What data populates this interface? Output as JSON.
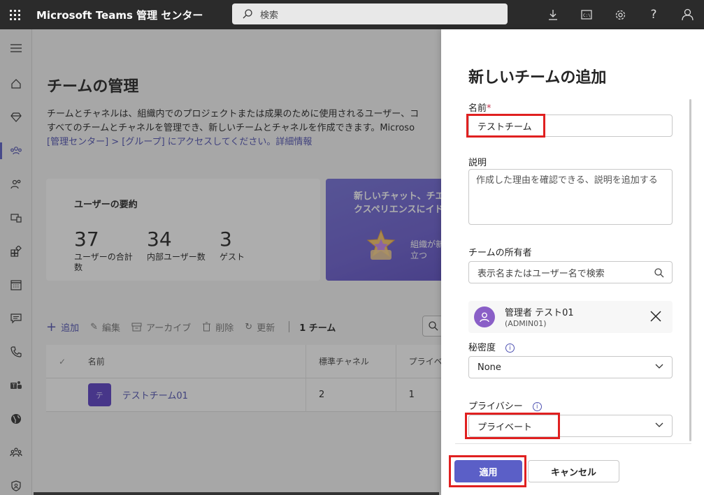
{
  "app": {
    "title": "Microsoft Teams 管理 センター"
  },
  "search": {
    "placeholder": "検索"
  },
  "topbar_icons": [
    "download-icon",
    "terminal-icon",
    "gear-icon",
    "help-icon",
    "user-icon"
  ],
  "rail_icons": [
    "hamburger-icon",
    "home-icon",
    "diamond-icon",
    "teams-icon",
    "users-icon",
    "devices-icon",
    "apps-icon",
    "calendar-icon",
    "chat-icon",
    "phone-icon",
    "teams-app-icon",
    "globe-icon",
    "people-icon",
    "shield-icon"
  ],
  "main": {
    "title": "チームの管理",
    "desc_line1": "チームとチャネルは、組織内でのプロジェクトまたは成果のために使用されるユーザー、コ",
    "desc_line2": "すべてのチームとチャネルを管理でき、新しいチームとチャネルを作成できます。Microso",
    "desc_line3_a": "[管理センター] > [グループ] にアクセスしてください。",
    "desc_line3_link": "詳細情報"
  },
  "user_summary": {
    "heading": "ユーザーの要約",
    "stats": [
      {
        "value": "37",
        "label": "ユーザーの合計数"
      },
      {
        "value": "34",
        "label": "内部ユーザー数"
      },
      {
        "value": "3",
        "label": "ゲスト"
      }
    ]
  },
  "promo": {
    "title": "新しいチャット、チエクスペリエンスにイド",
    "sub": "組織が新に役立つ"
  },
  "commands": {
    "add": "追加",
    "edit": "編集",
    "archive": "アーカイブ",
    "delete": "削除",
    "refresh": "更新",
    "count": "1 チーム"
  },
  "table": {
    "headers": {
      "name": "名前",
      "standard_channels": "標準チャネル",
      "privacy": "プライベ"
    },
    "rows": [
      {
        "avatar": "テ",
        "name": "テストチーム01",
        "standard_channels": "2",
        "privacy": "1"
      }
    ]
  },
  "panel": {
    "title": "新しいチームの追加",
    "name_label": "名前",
    "required_mark": "*",
    "name_value": "テストチーム",
    "desc_label": "説明",
    "desc_placeholder": "作成した理由を確認できる、説明を追加する",
    "owner_label": "チームの所有者",
    "owner_search_placeholder": "表示名またはユーザー名で検索",
    "owner": {
      "name": "管理者 テスト01",
      "id": "(ADMIN01)"
    },
    "sensitivity_label": "秘密度",
    "sensitivity_value": "None",
    "privacy_label": "プライバシー",
    "privacy_value": "プライベート",
    "apply": "適用",
    "cancel": "キャンセル"
  },
  "colors": {
    "accent": "#5b5fc7",
    "highlight": "#e02020",
    "topbar": "#2b2b2b"
  }
}
